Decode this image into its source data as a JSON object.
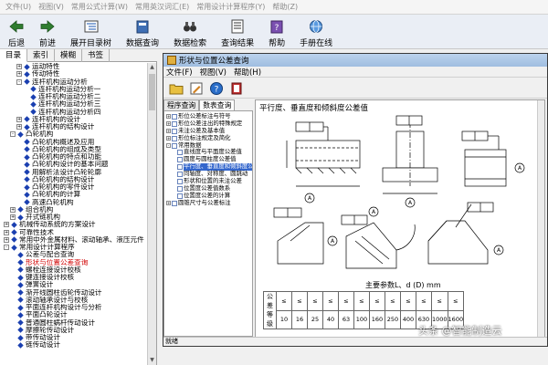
{
  "menubar": {
    "items": [
      "文件(U)",
      "视图(V)",
      "常用公式计算(W)",
      "常用英汉词汇(E)",
      "常用设计计算程序(Y)",
      "帮助(Z)"
    ]
  },
  "toolbar": {
    "back": "后退",
    "forward": "前进",
    "expand_tree": "展开目录树",
    "data_query": "数据查询",
    "data_search": "数据检索",
    "query_result": "查询结果",
    "help": "帮助",
    "manual_online": "手册在线"
  },
  "left_tabs": [
    "目录",
    "索引",
    "模糊",
    "书签"
  ],
  "left_tree": [
    {
      "indent": 2,
      "toggle": "+",
      "text": "运动特性"
    },
    {
      "indent": 2,
      "toggle": "+",
      "text": "传动特性"
    },
    {
      "indent": 2,
      "toggle": "-",
      "text": "连杆机构运动分析"
    },
    {
      "indent": 3,
      "toggle": "",
      "text": "连杆机构运动分析一"
    },
    {
      "indent": 3,
      "toggle": "",
      "text": "连杆机构运动分析二"
    },
    {
      "indent": 3,
      "toggle": "",
      "text": "连杆机构运动分析三"
    },
    {
      "indent": 3,
      "toggle": "",
      "text": "连杆机构运动分析四"
    },
    {
      "indent": 2,
      "toggle": "+",
      "text": "连杆机构的设计"
    },
    {
      "indent": 2,
      "toggle": "+",
      "text": "连杆机构的结构设计"
    },
    {
      "indent": 1,
      "toggle": "-",
      "text": "凸轮机构"
    },
    {
      "indent": 2,
      "toggle": "",
      "text": "凸轮机构概述及应用"
    },
    {
      "indent": 2,
      "toggle": "",
      "text": "凸轮机构的组成及类型"
    },
    {
      "indent": 2,
      "toggle": "",
      "text": "凸轮机构的特点和功能"
    },
    {
      "indent": 2,
      "toggle": "",
      "text": "凸轮机构设计的基本问题"
    },
    {
      "indent": 2,
      "toggle": "",
      "text": "用解析法设计凸轮轮廓"
    },
    {
      "indent": 2,
      "toggle": "",
      "text": "凸轮机构的结构设计"
    },
    {
      "indent": 2,
      "toggle": "",
      "text": "凸轮机构的零件设计"
    },
    {
      "indent": 2,
      "toggle": "",
      "text": "凸轮机构的计算"
    },
    {
      "indent": 2,
      "toggle": "",
      "text": "高速凸轮机构"
    },
    {
      "indent": 1,
      "toggle": "+",
      "text": "组合机构"
    },
    {
      "indent": 1,
      "toggle": "+",
      "text": "开式链机构"
    },
    {
      "indent": 0,
      "toggle": "+",
      "text": "机械传动系统的方案设计"
    },
    {
      "indent": 0,
      "toggle": "+",
      "text": "可靠性技术"
    },
    {
      "indent": 0,
      "toggle": "+",
      "text": "常用中外金属材料、滚动轴承、液压元件"
    },
    {
      "indent": 0,
      "toggle": "-",
      "text": "常用设计计算程序"
    },
    {
      "indent": 1,
      "toggle": "",
      "text": "公差与配合查询"
    },
    {
      "indent": 1,
      "toggle": "",
      "text": "形状与位置公差查询",
      "red": true
    },
    {
      "indent": 1,
      "toggle": "",
      "text": "螺栓连接设计校核"
    },
    {
      "indent": 1,
      "toggle": "",
      "text": "键连接设计校核"
    },
    {
      "indent": 1,
      "toggle": "",
      "text": "弹簧设计"
    },
    {
      "indent": 1,
      "toggle": "",
      "text": "渐开线圆柱齿轮传动设计"
    },
    {
      "indent": 1,
      "toggle": "",
      "text": "滚动轴承设计与校核"
    },
    {
      "indent": 1,
      "toggle": "",
      "text": "平面连杆机构设计与分析"
    },
    {
      "indent": 1,
      "toggle": "",
      "text": "平面凸轮设计"
    },
    {
      "indent": 1,
      "toggle": "",
      "text": "普通圆柱蜗杆传动设计"
    },
    {
      "indent": 1,
      "toggle": "",
      "text": "摩擦轮传动设计"
    },
    {
      "indent": 1,
      "toggle": "",
      "text": "带传动设计"
    },
    {
      "indent": 1,
      "toggle": "",
      "text": "链传动设计"
    }
  ],
  "child_window": {
    "title": "形状与位置公差查询",
    "menu": [
      "文件(F)",
      "视图(V)",
      "帮助(H)"
    ],
    "inner_tabs": [
      "程序查询",
      "数表查询"
    ],
    "inner_tree": [
      {
        "indent": 0,
        "toggle": "+",
        "text": "形位公差标注与符号"
      },
      {
        "indent": 0,
        "toggle": "+",
        "text": "形位公差注出的特殊规定"
      },
      {
        "indent": 0,
        "toggle": "+",
        "text": "未注公差及基本值"
      },
      {
        "indent": 0,
        "toggle": "+",
        "text": "形位标注规定及简化"
      },
      {
        "indent": 0,
        "toggle": "-",
        "text": "常用数据"
      },
      {
        "indent": 1,
        "toggle": "",
        "text": "直线度与平面度公差值"
      },
      {
        "indent": 1,
        "toggle": "",
        "text": "圆度与圆柱度公差值"
      },
      {
        "indent": 1,
        "toggle": "",
        "text": "平行度、垂直度和倾斜度公差值",
        "selected": true
      },
      {
        "indent": 1,
        "toggle": "",
        "text": "同轴度、对称度、圆跳动"
      },
      {
        "indent": 1,
        "toggle": "",
        "text": "形状和位置的未注公差"
      },
      {
        "indent": 1,
        "toggle": "",
        "text": "位置度公差值数系"
      },
      {
        "indent": 1,
        "toggle": "",
        "text": "位置度公差的计算"
      },
      {
        "indent": 0,
        "toggle": "+",
        "text": "圆锥尺寸与公差标注"
      }
    ],
    "content_title": "平行度、垂直度和倾斜度公差值",
    "table_caption": "主要参数L、d (D) mm",
    "table_row_label": "公差等级",
    "table_header_label": "≤",
    "table_values": [
      "10",
      "16",
      "25",
      "40",
      "63",
      "100",
      "160",
      "250",
      "400",
      "630",
      "1000",
      "1600"
    ],
    "datum_letter": "A",
    "status": "就绪"
  },
  "watermark": "头条 @智能制造云"
}
